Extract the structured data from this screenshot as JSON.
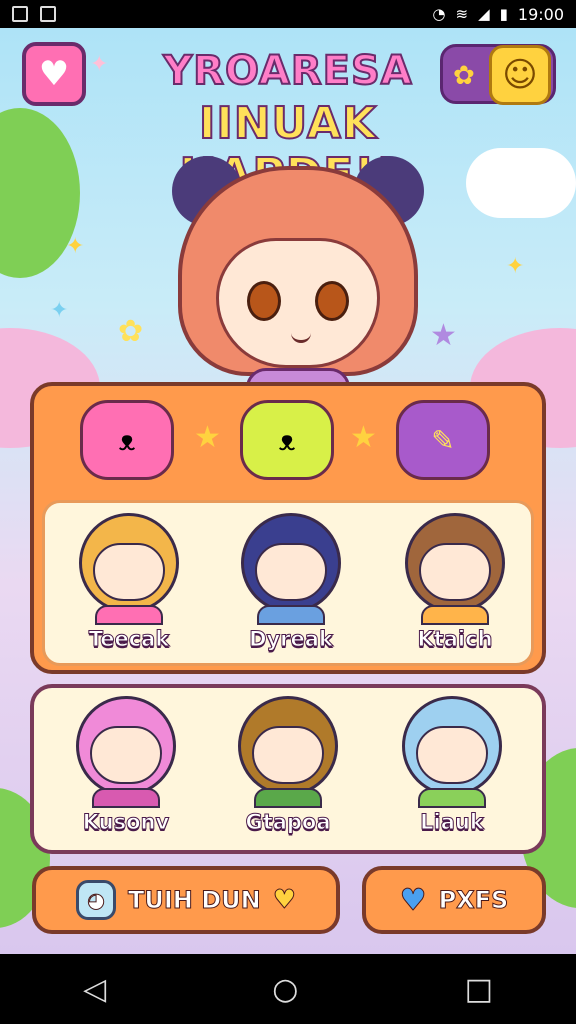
{
  "status_bar": {
    "time": "19:00",
    "icons": [
      "notification-icon",
      "image-icon",
      "alarm-icon",
      "wifi-icon",
      "signal-icon",
      "battery-icon"
    ]
  },
  "header": {
    "title_line1": "YROARESA",
    "title_line2": "IINUAK HAPDE!!",
    "left_button_icon": "heart-icon",
    "profile_icons": [
      "flower-icon",
      "smiley-icon"
    ]
  },
  "category_tabs": [
    {
      "icon": "pink-bear-icon"
    },
    {
      "icon": "lime-bear-icon"
    },
    {
      "icon": "purple-item-icon"
    }
  ],
  "characters_row1": [
    {
      "name": "Teecak",
      "hair": "#f3b64a",
      "shirt": "#ff6fb3"
    },
    {
      "name": "Dyreak",
      "hair": "#3a3f8f",
      "shirt": "#6aa0e0"
    },
    {
      "name": "Ktaich",
      "hair": "#a0663c",
      "shirt": "#ffb44a"
    }
  ],
  "characters_row2": [
    {
      "name": "Kusonv",
      "hair": "#f08ad8",
      "shirt": "#d85ab0"
    },
    {
      "name": "Gtapoa",
      "hair": "#b07a2a",
      "shirt": "#5aa84a"
    },
    {
      "name": "Liauk",
      "hair": "#9ed0f0",
      "shirt": "#8ad05a"
    }
  ],
  "buttons": {
    "left_label": "TUIH DUN",
    "right_label": "PXFS",
    "left_icon": "ghost-icon",
    "left_badge_icon": "heart-badge-icon",
    "right_icon": "blue-heart-icon"
  },
  "nav": [
    "back-icon",
    "home-icon",
    "recents-icon"
  ],
  "colors": {
    "accent_orange": "#ff9a4c",
    "accent_pink": "#ff6fb3",
    "panel_cream": "#fff6dc"
  }
}
